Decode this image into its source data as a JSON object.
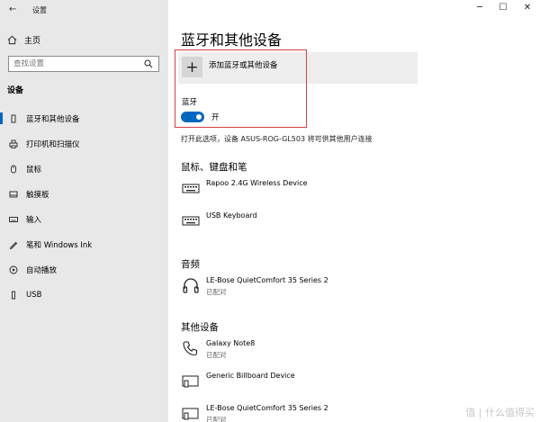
{
  "window": {
    "title": "设置",
    "minimize": "─",
    "maximize": "☐",
    "close": "✕"
  },
  "sidebar": {
    "home_label": "主页",
    "search_placeholder": "查找设置",
    "section_title": "设备",
    "items": [
      {
        "label": "蓝牙和其他设备",
        "icon": "bluetooth-icon",
        "active": true
      },
      {
        "label": "打印机和扫描仪",
        "icon": "printer-icon",
        "active": false
      },
      {
        "label": "鼠标",
        "icon": "mouse-icon",
        "active": false
      },
      {
        "label": "触摸板",
        "icon": "touchpad-icon",
        "active": false
      },
      {
        "label": "输入",
        "icon": "keyboard-icon",
        "active": false
      },
      {
        "label": "笔和 Windows Ink",
        "icon": "pen-icon",
        "active": false
      },
      {
        "label": "自动播放",
        "icon": "autoplay-icon",
        "active": false
      },
      {
        "label": "USB",
        "icon": "usb-icon",
        "active": false
      }
    ]
  },
  "main": {
    "title": "蓝牙和其他设备",
    "add_device_label": "添加蓝牙或其他设备",
    "add_symbol": "+",
    "bluetooth_label": "蓝牙",
    "bluetooth_state": "开",
    "discoverable_text": "打开此选项，设备 ASUS-ROG-GL503 将可供其他用户连接",
    "groups": [
      {
        "title": "鼠标、键盘和笔",
        "devices": [
          {
            "name": "Rapoo 2.4G Wireless Device",
            "status": "",
            "icon": "keyboard-icon"
          },
          {
            "name": "USB Keyboard",
            "status": "",
            "icon": "keyboard-icon"
          }
        ]
      },
      {
        "title": "音频",
        "devices": [
          {
            "name": "LE-Bose QuietComfort 35 Series 2",
            "status": "已配对",
            "icon": "headphones-icon"
          }
        ]
      },
      {
        "title": "其他设备",
        "devices": [
          {
            "name": "Galaxy Note8",
            "status": "已配对",
            "icon": "phone-icon"
          },
          {
            "name": "Generic Billboard Device",
            "status": "",
            "icon": "device-icon"
          },
          {
            "name": "LE-Bose QuietComfort 35 Series 2",
            "status": "已配对",
            "icon": "device-icon"
          }
        ]
      }
    ]
  },
  "watermark": "值 | 什么值得买",
  "colors": {
    "accent": "#0067c0",
    "highlight": "#d84040",
    "sidebar_bg": "#e8e8e8"
  }
}
